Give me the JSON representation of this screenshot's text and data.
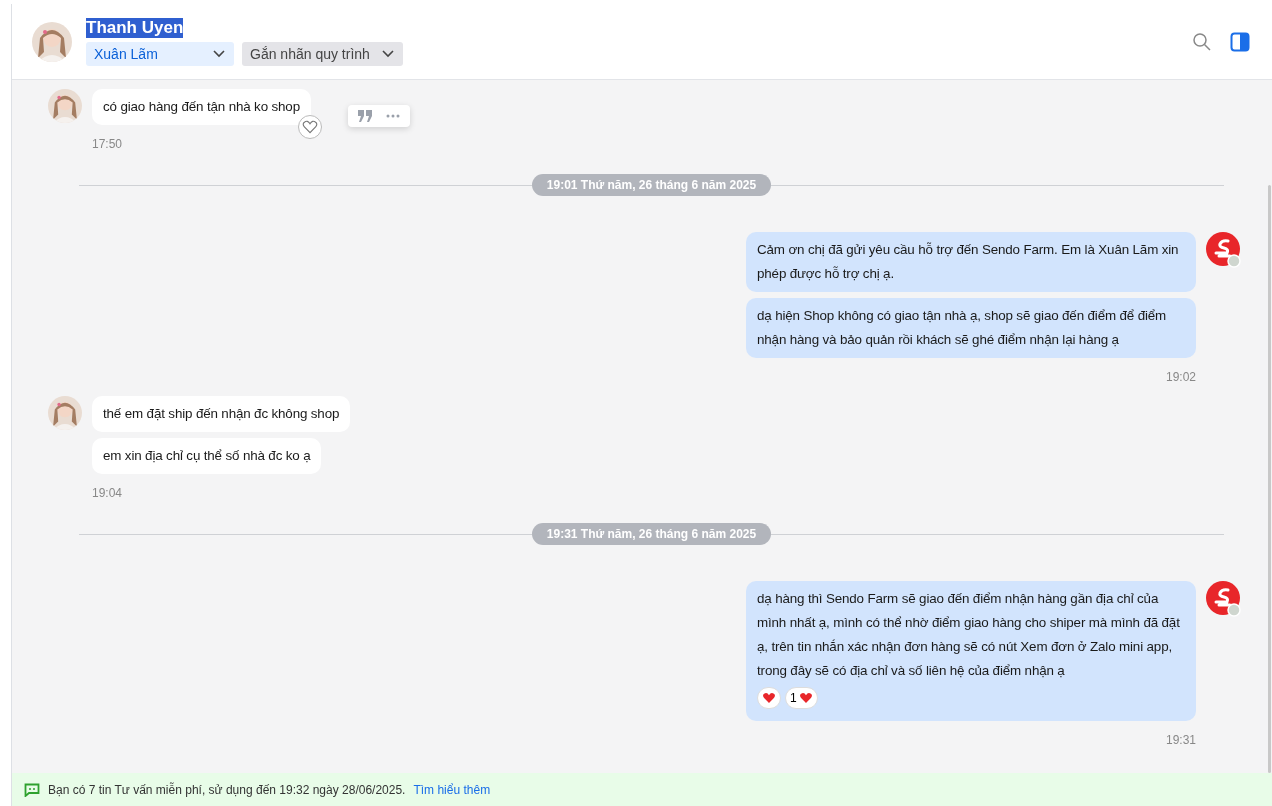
{
  "header": {
    "title": "Thanh Uyen",
    "title_selected": true,
    "assignee": "Xuân Lãm",
    "label_dropdown": "Gắn nhãn quy trình"
  },
  "feed": [
    {
      "kind": "incoming",
      "messages": [
        "có giao hàng đến tận nhà ko shop"
      ],
      "time": "17:50",
      "hover_actions": true
    },
    {
      "kind": "divider",
      "label": "19:01 Thứ năm, 26 tháng 6 năm 2025"
    },
    {
      "kind": "outgoing",
      "messages": [
        "Cảm ơn chị đã gửi yêu cầu hỗ trợ đến Sendo Farm. Em là Xuân Lãm xin phép được hỗ trợ chị ạ.",
        "dạ hiện Shop không có giao tận nhà ạ, shop sẽ giao đến điểm để điểm nhận hàng và bảo quản rồi khách sẽ ghé điểm nhận lại hàng ạ"
      ],
      "time": "19:02",
      "hover_actions": false
    },
    {
      "kind": "incoming",
      "messages": [
        "thế em đặt ship đến nhận đc không shop",
        "em xin địa chỉ cụ thể số nhà đc ko ạ"
      ],
      "time": "19:04",
      "hover_actions": false
    },
    {
      "kind": "divider",
      "label": "19:31 Thứ năm, 26 tháng 6 năm 2025"
    },
    {
      "kind": "outgoing",
      "messages": [
        "dạ hàng thì Sendo Farm sẽ giao đến điểm nhận hàng gần địa chỉ của mình nhất ạ, mình có thể nhờ điểm giao hàng cho shiper mà mình đã đặt ạ, trên tin nhắn xác nhận đơn hàng sẽ có nút Xem đơn ở Zalo mini app, trong đây sẽ có địa chỉ và số liên hệ của điểm nhận ạ"
      ],
      "time": "19:31",
      "hover_actions": false,
      "reaction_count": "1"
    }
  ],
  "banner": {
    "text": "Bạn có 7 tin Tư vấn miễn phí, sử dụng đến 19:32 ngày 28/06/2025.",
    "link": "Tìm hiểu thêm"
  }
}
